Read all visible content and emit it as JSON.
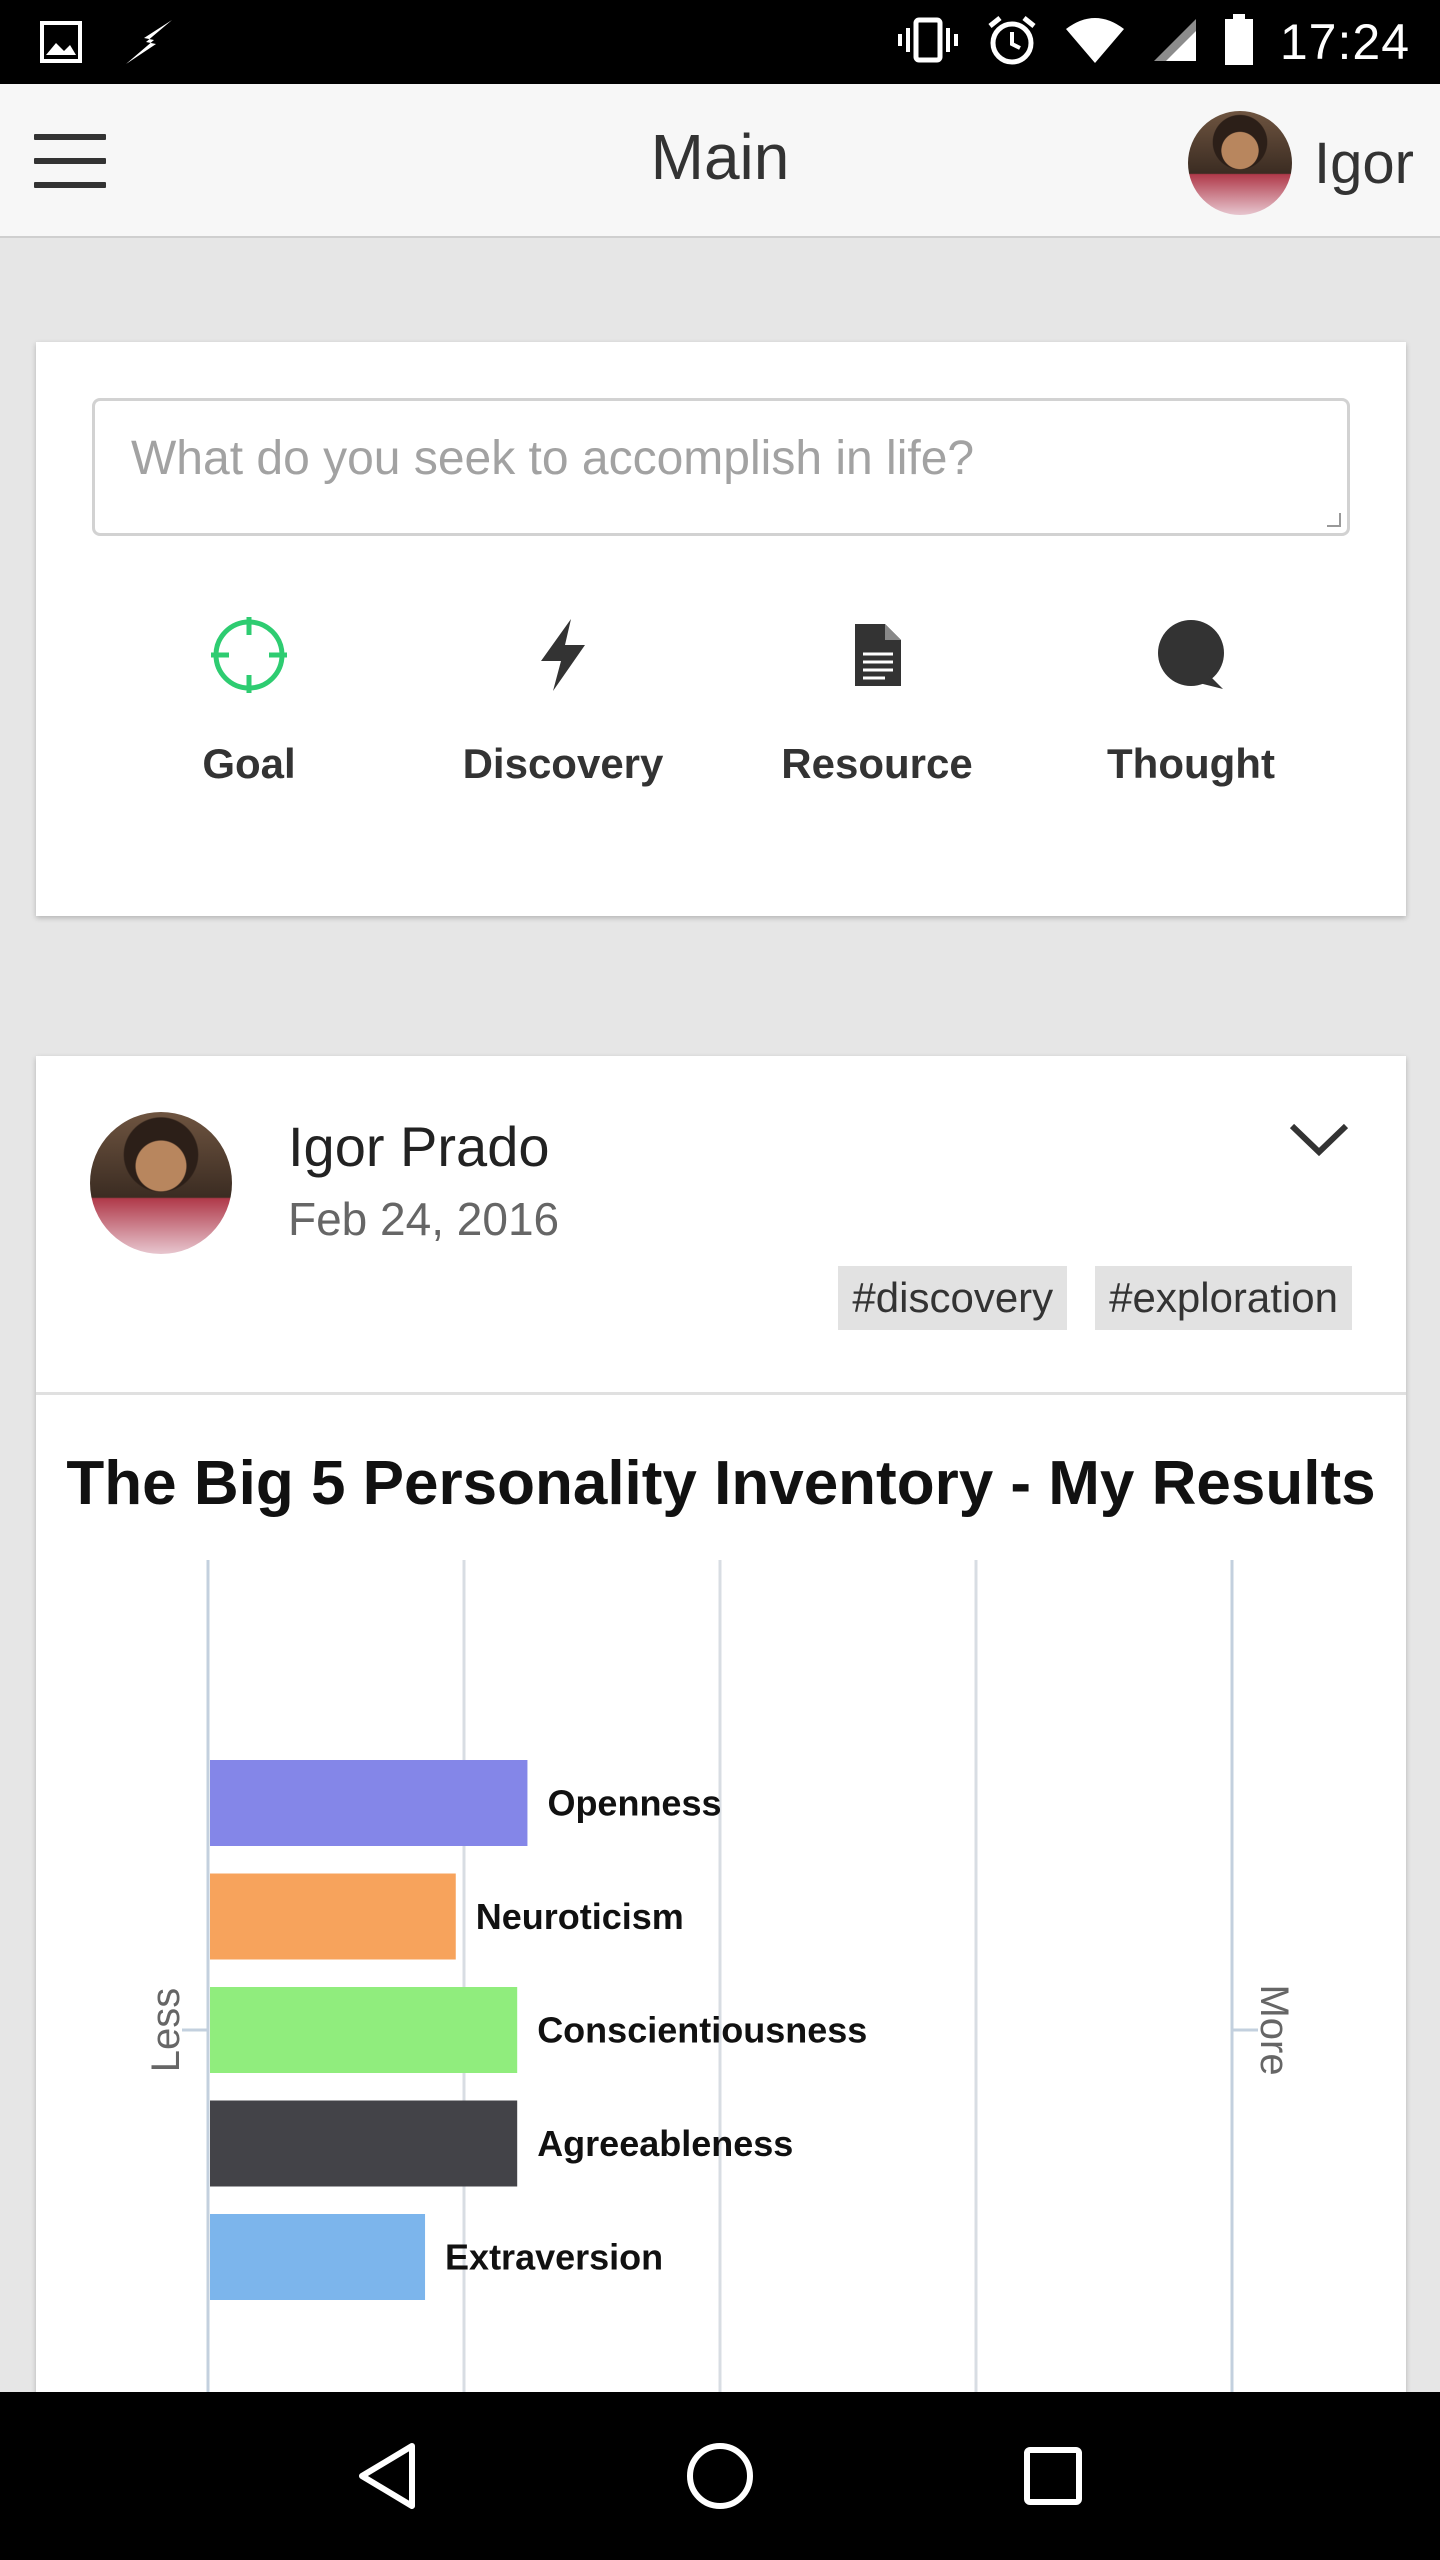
{
  "status_bar": {
    "time": "17:24"
  },
  "app_bar": {
    "title": "Main",
    "user_name": "Igor"
  },
  "compose": {
    "placeholder": "What do you seek to accomplish in life?",
    "actions": [
      {
        "label": "Goal",
        "icon": "crosshair-icon",
        "color": "#2ecc71"
      },
      {
        "label": "Discovery",
        "icon": "lightning-icon",
        "color": "#333333"
      },
      {
        "label": "Resource",
        "icon": "document-icon",
        "color": "#333333"
      },
      {
        "label": "Thought",
        "icon": "speech-bubble-icon",
        "color": "#333333"
      }
    ]
  },
  "post": {
    "author": "Igor Prado",
    "date": "Feb 24, 2016",
    "tags": [
      "#discovery",
      "#exploration"
    ],
    "title": "The Big 5 Personality Inventory - My Results"
  },
  "chart_data": {
    "type": "bar",
    "orientation": "horizontal",
    "title": "The Big 5 Personality Inventory - My Results",
    "categories": [
      "Openness",
      "Neuroticism",
      "Conscientiousness",
      "Agreeableness",
      "Extraversion"
    ],
    "values": [
      31,
      24,
      30,
      30,
      21
    ],
    "colors": [
      "#8486e8",
      "#f7a35c",
      "#90ed7d",
      "#434348",
      "#7cb5ec"
    ],
    "xlim": [
      0,
      100
    ],
    "axis_left_label": "Less",
    "axis_right_label": "More",
    "grid": true,
    "legend": "none"
  }
}
